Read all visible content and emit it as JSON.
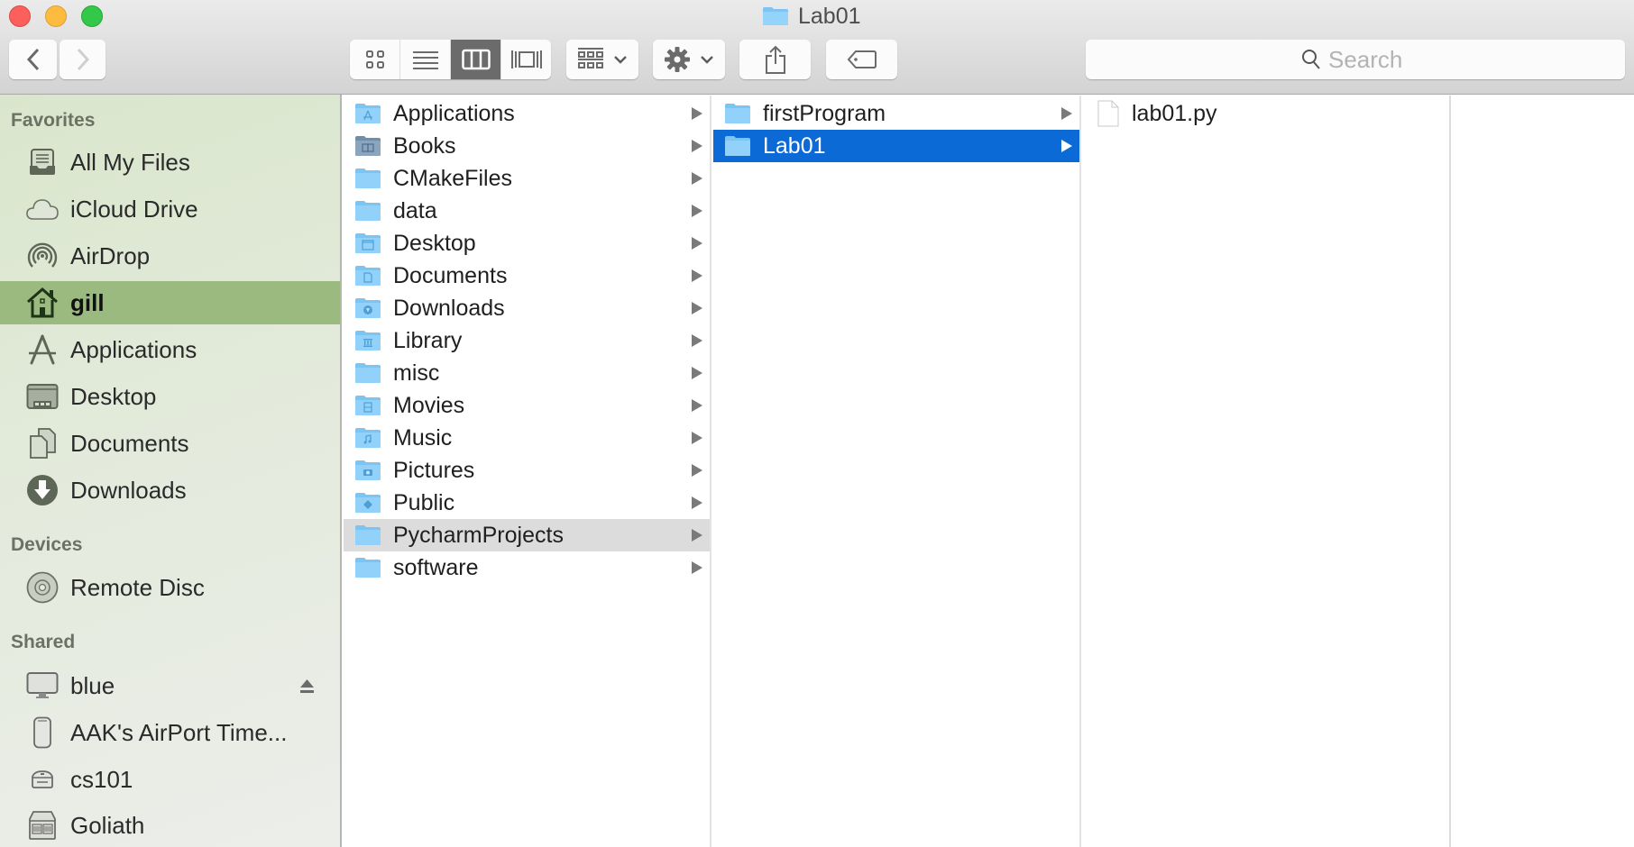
{
  "window": {
    "title": "Lab01",
    "title_icon": "folder-icon"
  },
  "toolbar": {
    "back": {
      "icon": "chevron-left-icon",
      "enabled": true
    },
    "forward": {
      "icon": "chevron-right-icon",
      "enabled": false
    },
    "view_modes": [
      {
        "name": "icon-view",
        "icon": "grid-icon",
        "active": false
      },
      {
        "name": "list-view",
        "icon": "list-icon",
        "active": false
      },
      {
        "name": "column-view",
        "icon": "columns-icon",
        "active": true
      },
      {
        "name": "cover-flow-view",
        "icon": "cover-flow-icon",
        "active": false
      }
    ],
    "arrange": {
      "icon": "arrange-icon",
      "dropdown": "chevron-down-icon"
    },
    "action": {
      "icon": "gear-icon",
      "dropdown": "chevron-down-icon"
    },
    "share": {
      "icon": "share-icon"
    },
    "tag": {
      "icon": "tag-icon"
    },
    "search": {
      "placeholder": "Search",
      "value": ""
    }
  },
  "sidebar": {
    "sections": {
      "favorites": "Favorites",
      "devices": "Devices",
      "shared": "Shared"
    },
    "favorites": [
      {
        "label": "All My Files",
        "icon": "all-files-icon"
      },
      {
        "label": "iCloud Drive",
        "icon": "cloud-icon"
      },
      {
        "label": "AirDrop",
        "icon": "airdrop-icon"
      },
      {
        "label": "gill",
        "icon": "home-icon",
        "selected": true
      },
      {
        "label": "Applications",
        "icon": "applications-icon"
      },
      {
        "label": "Desktop",
        "icon": "desktop-icon"
      },
      {
        "label": "Documents",
        "icon": "documents-icon"
      },
      {
        "label": "Downloads",
        "icon": "downloads-icon"
      }
    ],
    "devices": [
      {
        "label": "Remote Disc",
        "icon": "disc-icon"
      }
    ],
    "shared": [
      {
        "label": "blue",
        "icon": "imac-icon",
        "eject": true
      },
      {
        "label": "AAK's AirPort Time...",
        "icon": "airport-icon"
      },
      {
        "label": "cs101",
        "icon": "mac-mini-icon"
      },
      {
        "label": "Goliath",
        "icon": "server-icon"
      }
    ]
  },
  "columns": [
    {
      "items": [
        {
          "label": "Applications",
          "icon": "folder-applications-icon",
          "has_children": true
        },
        {
          "label": "Books",
          "icon": "folder-books-icon",
          "has_children": true
        },
        {
          "label": "CMakeFiles",
          "icon": "folder-icon",
          "has_children": true
        },
        {
          "label": "data",
          "icon": "folder-icon",
          "has_children": true
        },
        {
          "label": "Desktop",
          "icon": "folder-desktop-icon",
          "has_children": true
        },
        {
          "label": "Documents",
          "icon": "folder-documents-icon",
          "has_children": true
        },
        {
          "label": "Downloads",
          "icon": "folder-downloads-icon",
          "has_children": true
        },
        {
          "label": "Library",
          "icon": "folder-library-icon",
          "has_children": true
        },
        {
          "label": "misc",
          "icon": "folder-icon",
          "has_children": true
        },
        {
          "label": "Movies",
          "icon": "folder-movies-icon",
          "has_children": true
        },
        {
          "label": "Music",
          "icon": "folder-music-icon",
          "has_children": true
        },
        {
          "label": "Pictures",
          "icon": "folder-pictures-icon",
          "has_children": true
        },
        {
          "label": "Public",
          "icon": "folder-public-icon",
          "has_children": true
        },
        {
          "label": "PycharmProjects",
          "icon": "folder-icon",
          "has_children": true,
          "state": "path-selected"
        },
        {
          "label": "software",
          "icon": "folder-icon",
          "has_children": true
        }
      ]
    },
    {
      "items": [
        {
          "label": "firstProgram",
          "icon": "folder-icon",
          "has_children": true
        },
        {
          "label": "Lab01",
          "icon": "folder-icon",
          "has_children": true,
          "state": "selected"
        }
      ]
    },
    {
      "items": [
        {
          "label": "lab01.py",
          "icon": "document-icon",
          "has_children": false
        }
      ]
    }
  ],
  "colors": {
    "selection": "#0c6ad6",
    "path_selection": "#dcdcdc",
    "sidebar_selection": "#9bba80",
    "folder": "#8fd0f8"
  }
}
